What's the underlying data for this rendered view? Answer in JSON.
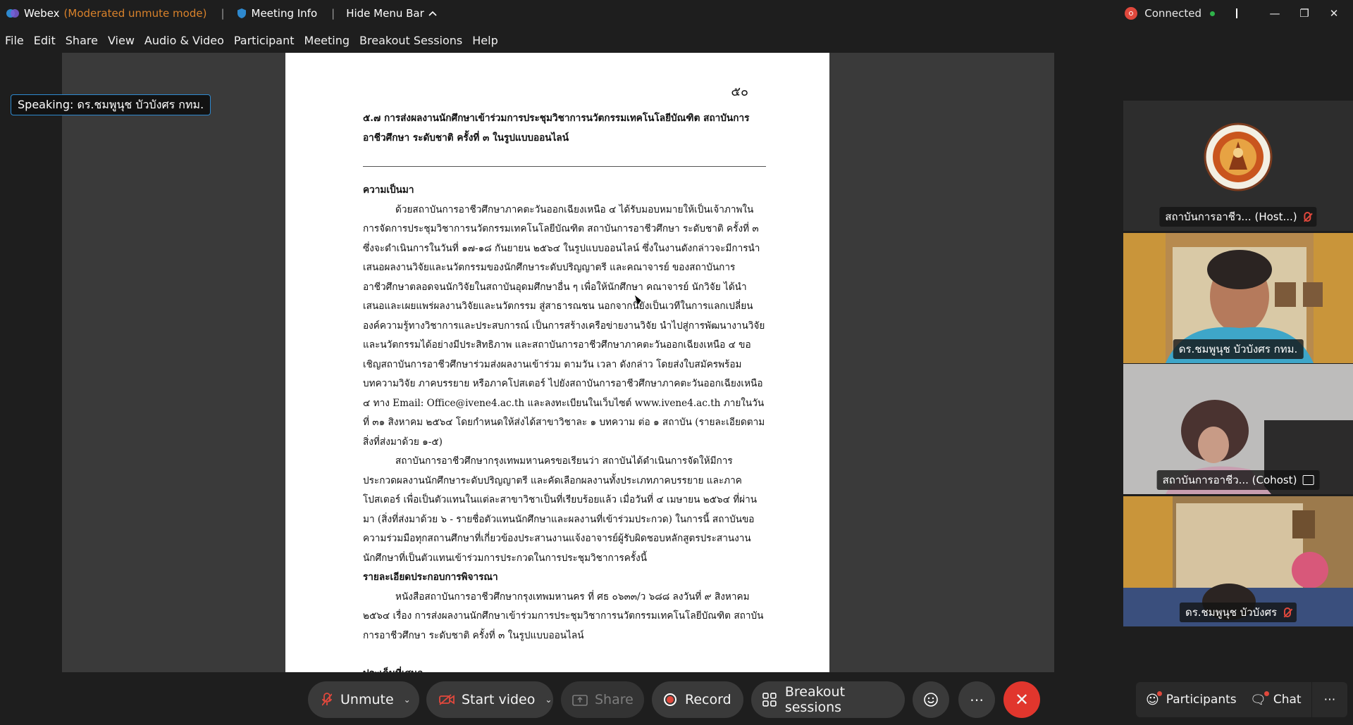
{
  "titlebar": {
    "app": "Webex",
    "mode": "(Moderated unmute mode)",
    "meeting_info": "Meeting Info",
    "hide_menu": "Hide Menu Bar",
    "status": "Connected"
  },
  "menu": [
    "File",
    "Edit",
    "Share",
    "View",
    "Audio & Video",
    "Participant",
    "Meeting",
    "Breakout Sessions",
    "Help"
  ],
  "speaking": "Speaking: ดร.ชมพูนุช บัวบังศร กทม.",
  "document": {
    "page_number": "๕๐",
    "heading": "๕.๗ การส่งผลงานนักศึกษาเข้าร่วมการประชุมวิชาการนวัตกรรมเทคโนโลยีบัณฑิต สถาบันการอาชีวศึกษา ระดับชาติ ครั้งที่ ๓ ในรูปแบบออนไลน์",
    "section1": "ความเป็นมา",
    "para1": "ด้วยสถาบันการอาชีวศึกษาภาคตะวันออกเฉียงเหนือ ๔ ได้รับมอบหมายให้เป็นเจ้าภาพในการจัดการประชุมวิชาการนวัตกรรมเทคโนโลยีบัณฑิต สถาบันการอาชีวศึกษา ระดับชาติ ครั้งที่ ๓ ซึ่งจะดำเนินการในวันที่ ๑๗-๑๘ กันยายน ๒๕๖๔ ในรูปแบบออนไลน์ ซึ่งในงานดังกล่าวจะมีการนำเสนอผลงานวิจัยและนวัตกรรมของนักศึกษาระดับปริญญาตรี และคณาจารย์ ของสถาบันการอาชีวศึกษาตลอดจนนักวิจัยในสถาบันอุดมศึกษาอื่น ๆ เพื่อให้นักศึกษา คณาจารย์ นักวิจัย ได้นำเสนอและเผยแพร่ผลงานวิจัยและนวัตกรรม สู่สาธารณชน นอกจากนี้ยังเป็นเวทีในการแลกเปลี่ยนองค์ความรู้ทางวิชาการและประสบการณ์ เป็นการสร้างเครือข่ายงานวิจัย นำไปสู่การพัฒนางานวิจัยและนวัตกรรมได้อย่างมีประสิทธิภาพ และสถาบันการอาชีวศึกษาภาคตะวันออกเฉียงเหนือ ๔ ขอเชิญสถาบันการอาชีวศึกษาร่วมส่งผลงานเข้าร่วม ตามวัน เวลา ดังกล่าว โดยส่งใบสมัครพร้อมบทความวิจัย ภาคบรรยาย หรือภาคโปสเตอร์ ไปยังสถาบันการอาชีวศึกษาภาคตะวันออกเฉียงเหนือ ๔ ทาง Email: Office@ivene4.ac.th และลงทะเบียนในเว็บไซต์ www.ivene4.ac.th ภายในวันที่ ๓๑ สิงหาคม ๒๕๖๔ โดยกำหนดให้ส่งได้สาขาวิชาละ ๑ บทความ ต่อ ๑ สถาบัน (รายละเอียดตามสิ่งที่ส่งมาด้วย ๑-๕)",
    "para2": "สถาบันการอาชีวศึกษากรุงเทพมหานครขอเรียนว่า สถาบันได้ดำเนินการจัดให้มีการประกวดผลงานนักศึกษาระดับปริญญาตรี และคัดเลือกผลงานทั้งประเภทภาคบรรยาย และภาคโปสเตอร์ เพื่อเป็นตัวแทนในแต่ละสาขาวิชาเป็นที่เรียบร้อยแล้ว เมื่อวันที่ ๔ เมษายน ๒๕๖๔ ที่ผ่านมา (สิ่งที่ส่งมาด้วย ๖ - รายชื่อตัวแทนนักศึกษาและผลงานที่เข้าร่วมประกวด) ในการนี้ สถาบันขอความร่วมมือทุกสถานศึกษาที่เกี่ยวข้องประสานงานแจ้งอาจารย์ผู้รับผิดชอบหลักสูตรประสานงานนักศึกษาที่เป็นตัวแทนเข้าร่วมการประกวดในการประชุมวิชาการครั้งนี้",
    "section2": "รายละเอียดประกอบการพิจารณา",
    "para3": "หนังสือสถาบันการอาชีวศึกษากรุงเทพมหานคร ที่ ศธ ๐๖๓๓/ว ๖๘๘ ลงวันที่ ๙ สิงหาคม ๒๕๖๔ เรื่อง การส่งผลงานนักศึกษาเข้าร่วมการประชุมวิชาการนวัตกรรมเทคโนโลยีบัณฑิต สถาบันการอาชีวศึกษา ระดับชาติ ครั้งที่ ๓ ในรูปแบบออนไลน์",
    "section3": "ประเด็นที่เสนอ"
  },
  "participants": [
    {
      "name": "สถาบันการอาชีว... (Host...)",
      "muted": true
    },
    {
      "name": "ดร.ชมพูนุช บัวบังศร กทม.",
      "muted": false
    },
    {
      "name": "สถาบันการอาชีว... (Cohost)",
      "sharing": true
    },
    {
      "name": "ดร.ชมพูนุช บัวบังศร",
      "muted": true
    }
  ],
  "controls": {
    "unmute": "Unmute",
    "start_video": "Start video",
    "share": "Share",
    "record": "Record",
    "breakout": "Breakout sessions",
    "participants": "Participants",
    "chat": "Chat"
  },
  "colors": {
    "accent": "#2cb3e8",
    "end_call": "#e1362d",
    "mode_text": "#d9822b"
  }
}
